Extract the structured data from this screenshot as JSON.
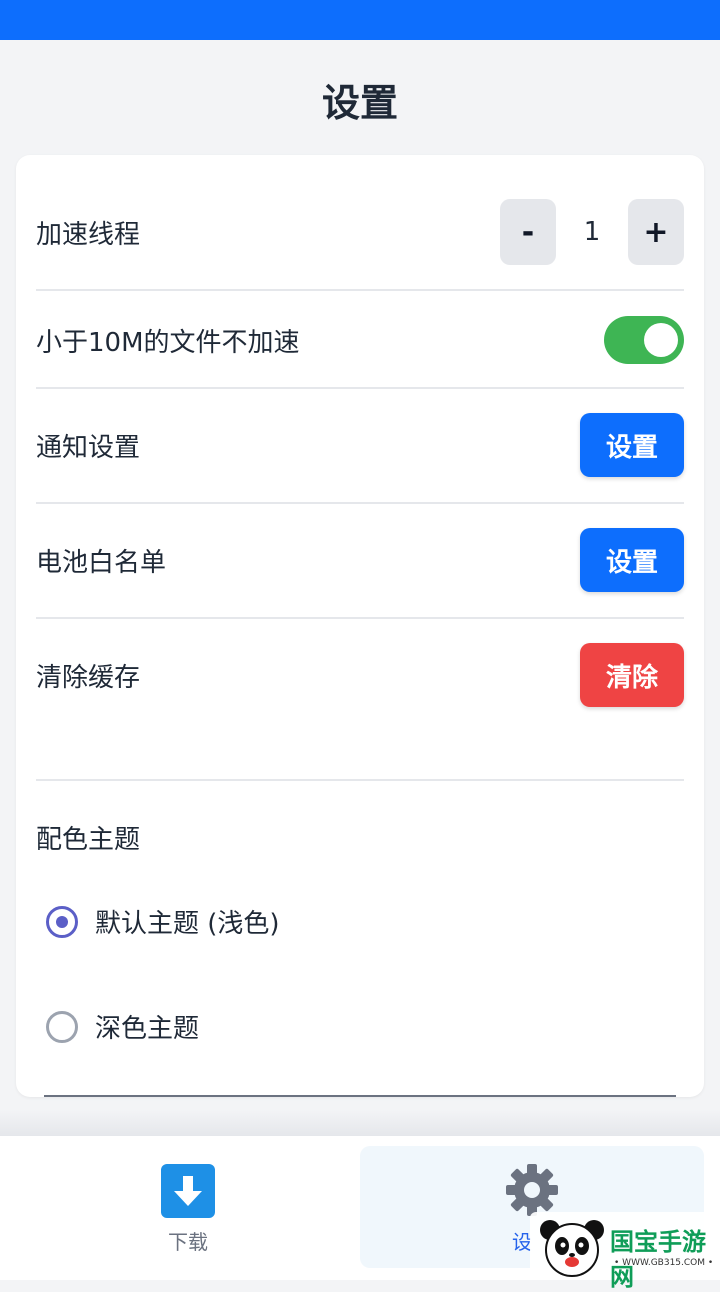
{
  "header": {
    "title": "设置"
  },
  "settings": {
    "threads": {
      "label": "加速线程",
      "minus": "-",
      "value": "1",
      "plus": "+"
    },
    "small_file": {
      "label": "小于10M的文件不加速",
      "enabled": true
    },
    "notification": {
      "label": "通知设置",
      "button": "设置"
    },
    "battery": {
      "label": "电池白名单",
      "button": "设置"
    },
    "cache": {
      "label": "清除缓存",
      "button": "清除"
    }
  },
  "theme": {
    "title": "配色主题",
    "options": [
      {
        "label": "默认主题 (浅色)",
        "selected": true
      },
      {
        "label": "深色主题",
        "selected": false
      }
    ]
  },
  "bottom_nav": {
    "items": [
      {
        "label": "下载",
        "icon": "download-arrow-icon",
        "active": false
      },
      {
        "label": "设",
        "icon": "gear-icon",
        "active": true
      }
    ]
  },
  "watermark": {
    "text": "国宝手游网",
    "sub": "• WWW.GB315.COM •"
  },
  "colors": {
    "primary": "#0d6efd",
    "danger": "#ef4444",
    "toggle_on": "#3eb554",
    "radio_selected": "#5b5fc7"
  }
}
